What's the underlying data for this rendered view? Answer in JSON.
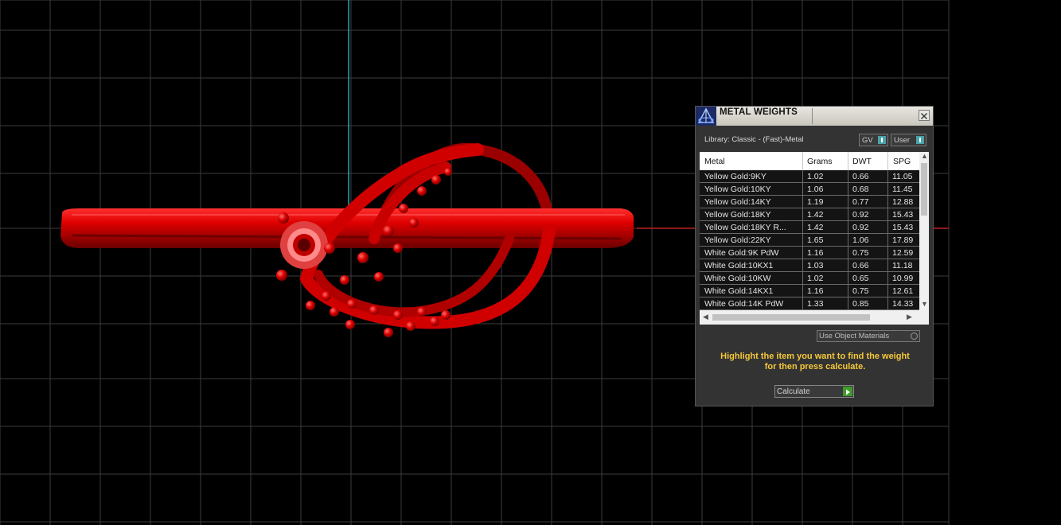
{
  "dialog": {
    "title": "METAL WEIGHTS",
    "library_label": "Library: Classic - (Fast)-Metal",
    "mode_buttons": [
      {
        "label": "GV"
      },
      {
        "label": "User"
      }
    ],
    "table": {
      "columns": [
        "Metal",
        "Grams",
        "DWT",
        "SPG"
      ],
      "rows": [
        [
          "Yellow Gold:9KY",
          "1.02",
          "0.66",
          "11.05"
        ],
        [
          "Yellow Gold:10KY",
          "1.06",
          "0.68",
          "11.45"
        ],
        [
          "Yellow Gold:14KY",
          "1.19",
          "0.77",
          "12.88"
        ],
        [
          "Yellow Gold:18KY",
          "1.42",
          "0.92",
          "15.43"
        ],
        [
          "Yellow Gold:18KY R...",
          "1.42",
          "0.92",
          "15.43"
        ],
        [
          "Yellow Gold:22KY",
          "1.65",
          "1.06",
          "17.89"
        ],
        [
          "White Gold:9K PdW",
          "1.16",
          "0.75",
          "12.59"
        ],
        [
          "White Gold:10KX1",
          "1.03",
          "0.66",
          "11.18"
        ],
        [
          "White Gold:10KW",
          "1.02",
          "0.65",
          "10.99"
        ],
        [
          "White Gold:14KX1",
          "1.16",
          "0.75",
          "12.61"
        ],
        [
          "White Gold:14K PdW",
          "1.33",
          "0.85",
          "14.33"
        ]
      ]
    },
    "use_object_materials_label": "Use Object Materials",
    "hint_line1": "Highlight the item you want to find the weight",
    "hint_line2": "for then press calculate.",
    "calculate_label": "Calculate"
  },
  "colors": {
    "background": "#000000",
    "grid": "#3c3c3c",
    "axis_vertical": "#2ea3b3",
    "axis_horizontal": "#c02020",
    "model_red": "#d40000",
    "hint_yellow": "#f5c83a",
    "go_green": "#3f9a2a"
  },
  "icons": {
    "app_logo": "matrix-logo-icon",
    "close": "close-icon",
    "info": "info-icon",
    "play": "play-arrow-icon"
  }
}
